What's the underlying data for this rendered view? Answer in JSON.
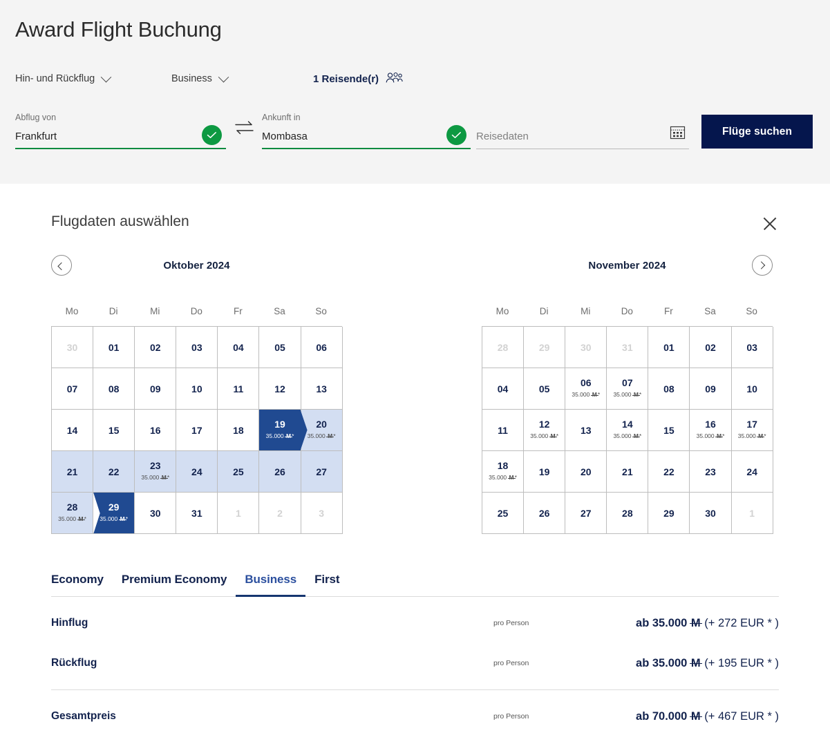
{
  "header": {
    "title": "Award Flight Buchung",
    "trip_type": "Hin- und Rückflug",
    "cabin_class": "Business",
    "passengers": "1 Reisende(r)",
    "from_label": "Abflug von",
    "from_value": "Frankfurt",
    "to_label": "Ankunft in",
    "to_value": "Mombasa",
    "date_label": "Reisedaten",
    "date_value": "",
    "date_placeholder": "Reisedaten",
    "search_button": "Flüge suchen",
    "button_color": "#05164D",
    "valid_color": "#0D9942"
  },
  "picker": {
    "title": "Flugdaten auswählen",
    "close_label": "Schließen",
    "weekdays": [
      "Mo",
      "Di",
      "Mi",
      "Do",
      "Fr",
      "Sa",
      "So"
    ],
    "price_unit": "M*",
    "selected_color": "#204A91",
    "range_color": "#D3DEF2",
    "months": [
      {
        "name": "Oktober 2024",
        "nav": "prev",
        "days": [
          {
            "n": "30",
            "state": "muted"
          },
          {
            "n": "01",
            "state": "normal"
          },
          {
            "n": "02",
            "state": "normal"
          },
          {
            "n": "03",
            "state": "normal"
          },
          {
            "n": "04",
            "state": "normal"
          },
          {
            "n": "05",
            "state": "normal"
          },
          {
            "n": "06",
            "state": "normal"
          },
          {
            "n": "07",
            "state": "normal"
          },
          {
            "n": "08",
            "state": "normal"
          },
          {
            "n": "09",
            "state": "normal"
          },
          {
            "n": "10",
            "state": "normal"
          },
          {
            "n": "11",
            "state": "normal"
          },
          {
            "n": "12",
            "state": "normal"
          },
          {
            "n": "13",
            "state": "normal"
          },
          {
            "n": "14",
            "state": "normal"
          },
          {
            "n": "15",
            "state": "normal"
          },
          {
            "n": "16",
            "state": "normal"
          },
          {
            "n": "17",
            "state": "normal"
          },
          {
            "n": "18",
            "state": "normal"
          },
          {
            "n": "19",
            "state": "selected-start",
            "price": "35.000"
          },
          {
            "n": "20",
            "state": "inrange",
            "price": "35.000"
          },
          {
            "n": "21",
            "state": "inrange"
          },
          {
            "n": "22",
            "state": "inrange"
          },
          {
            "n": "23",
            "state": "inrange",
            "price": "35.000"
          },
          {
            "n": "24",
            "state": "inrange"
          },
          {
            "n": "25",
            "state": "inrange"
          },
          {
            "n": "26",
            "state": "inrange"
          },
          {
            "n": "27",
            "state": "inrange"
          },
          {
            "n": "28",
            "state": "inrange",
            "price": "35.000"
          },
          {
            "n": "29",
            "state": "selected-end",
            "price": "35.000"
          },
          {
            "n": "30",
            "state": "normal"
          },
          {
            "n": "31",
            "state": "normal"
          },
          {
            "n": "1",
            "state": "muted"
          },
          {
            "n": "2",
            "state": "muted"
          },
          {
            "n": "3",
            "state": "muted"
          }
        ]
      },
      {
        "name": "November 2024",
        "nav": "next",
        "days": [
          {
            "n": "28",
            "state": "muted"
          },
          {
            "n": "29",
            "state": "muted"
          },
          {
            "n": "30",
            "state": "muted"
          },
          {
            "n": "31",
            "state": "muted"
          },
          {
            "n": "01",
            "state": "normal"
          },
          {
            "n": "02",
            "state": "normal"
          },
          {
            "n": "03",
            "state": "normal"
          },
          {
            "n": "04",
            "state": "normal"
          },
          {
            "n": "05",
            "state": "normal"
          },
          {
            "n": "06",
            "state": "normal",
            "price": "35.000"
          },
          {
            "n": "07",
            "state": "normal",
            "price": "35.000"
          },
          {
            "n": "08",
            "state": "normal"
          },
          {
            "n": "09",
            "state": "normal"
          },
          {
            "n": "10",
            "state": "normal"
          },
          {
            "n": "11",
            "state": "normal"
          },
          {
            "n": "12",
            "state": "normal",
            "price": "35.000"
          },
          {
            "n": "13",
            "state": "normal"
          },
          {
            "n": "14",
            "state": "normal",
            "price": "35.000"
          },
          {
            "n": "15",
            "state": "normal"
          },
          {
            "n": "16",
            "state": "normal",
            "price": "35.000"
          },
          {
            "n": "17",
            "state": "normal",
            "price": "35.000"
          },
          {
            "n": "18",
            "state": "normal",
            "price": "35.000"
          },
          {
            "n": "19",
            "state": "normal"
          },
          {
            "n": "20",
            "state": "normal"
          },
          {
            "n": "21",
            "state": "normal"
          },
          {
            "n": "22",
            "state": "normal"
          },
          {
            "n": "23",
            "state": "normal"
          },
          {
            "n": "24",
            "state": "normal"
          },
          {
            "n": "25",
            "state": "normal"
          },
          {
            "n": "26",
            "state": "normal"
          },
          {
            "n": "27",
            "state": "normal"
          },
          {
            "n": "28",
            "state": "normal"
          },
          {
            "n": "29",
            "state": "normal"
          },
          {
            "n": "30",
            "state": "normal"
          },
          {
            "n": "1",
            "state": "muted"
          }
        ]
      }
    ]
  },
  "cabin_tabs": [
    {
      "label": "Economy",
      "active": false
    },
    {
      "label": "Premium Economy",
      "active": false
    },
    {
      "label": "Business",
      "active": true
    },
    {
      "label": "First",
      "active": false
    }
  ],
  "summary": {
    "rows": [
      {
        "label": "Hinflug",
        "per": "pro Person",
        "prefix": "ab",
        "miles": "35.000",
        "unit": "M",
        "extra": "(+ 272 EUR * )"
      },
      {
        "label": "Rückflug",
        "per": "pro Person",
        "prefix": "ab",
        "miles": "35.000",
        "unit": "M",
        "extra": "(+ 195 EUR * )"
      }
    ],
    "total": {
      "label": "Gesamtpreis",
      "per": "pro Person",
      "prefix": "ab",
      "miles": "70.000",
      "unit": "M",
      "extra": "(+ 467 EUR * )"
    }
  }
}
